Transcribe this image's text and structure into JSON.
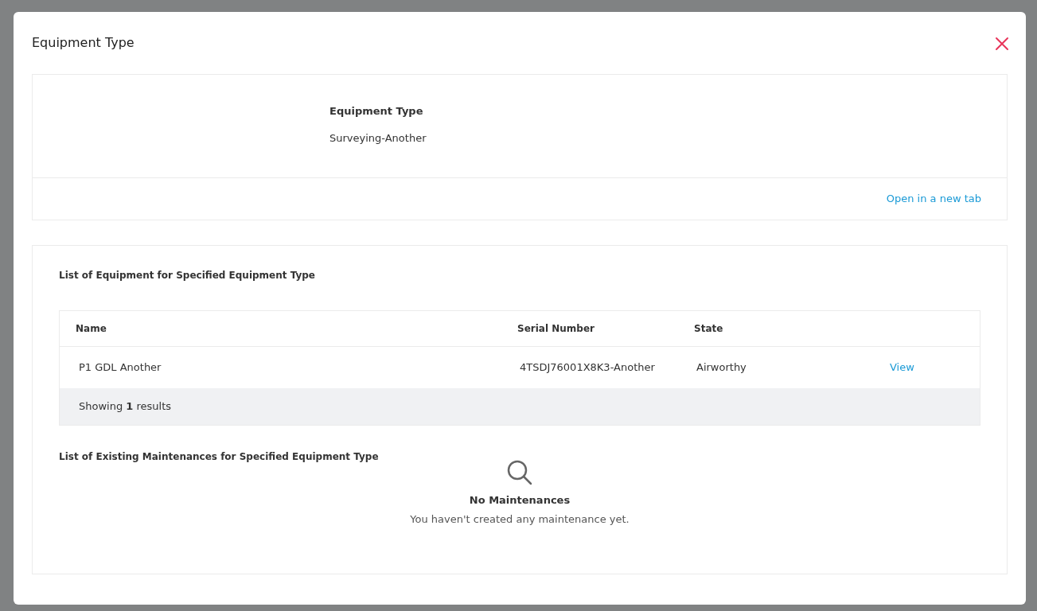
{
  "modal": {
    "title": "Equipment Type"
  },
  "details": {
    "label": "Equipment Type",
    "value": "Surveying-Another",
    "link": "Open in a new tab"
  },
  "equipment": {
    "title": "List of Equipment for Specified Equipment Type",
    "table": {
      "columns": [
        "Name",
        "Serial Number",
        "State"
      ],
      "rows": [
        {
          "cells": [
            "P1 GDL Another",
            "4TSDJ76001X8K3-Another",
            "Airworthy"
          ],
          "action": "View"
        }
      ],
      "footer": "Showing **1** results"
    }
  },
  "maintenances": {
    "title": "List of Existing Maintenances for Specified Equipment Type",
    "empty_title": "No Maintenances",
    "empty_text": "You haven't created any maintenance yet."
  }
}
